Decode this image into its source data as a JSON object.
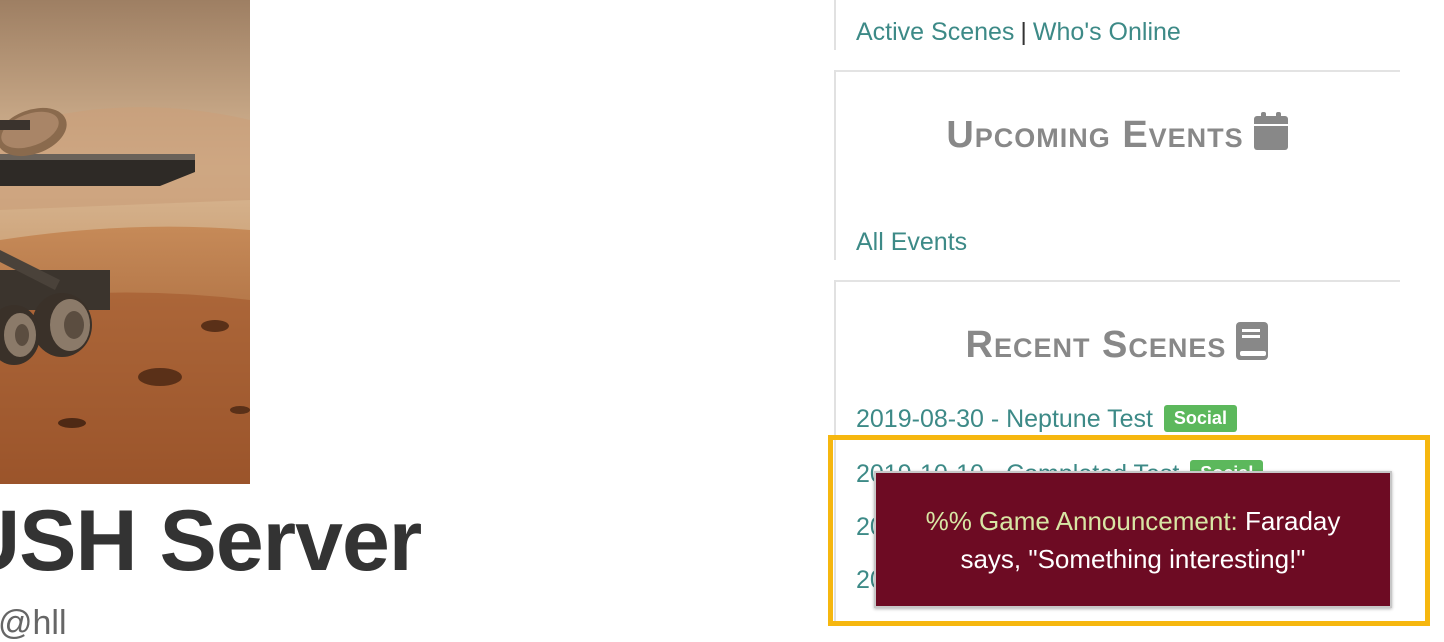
{
  "hero": {
    "title": "USH Server",
    "subtitle": "@hll"
  },
  "sidebar": {
    "links": {
      "active_scenes": "Active Scenes",
      "separator": "|",
      "whos_online": "Who's Online"
    },
    "upcoming_events": {
      "heading": "Upcoming Events",
      "icon": "calendar-icon",
      "all_events": "All Events"
    },
    "recent_scenes": {
      "heading": "Recent Scenes",
      "icon": "book-icon",
      "items": [
        {
          "label": "2019-08-30 - Neptune Test",
          "badge": "Social"
        },
        {
          "label": "2019-10-10 - Completed Test",
          "badge": "Social"
        },
        {
          "label": "20"
        },
        {
          "label": "20"
        }
      ]
    }
  },
  "notification": {
    "prefix": "%% Game Announcement:",
    "message": " Faraday says, \"Something interesting!\""
  },
  "colors": {
    "link": "#3d8a87",
    "badge": "#5cb85c",
    "toast_bg": "#6d0b23",
    "highlight": "#f6b70f"
  }
}
